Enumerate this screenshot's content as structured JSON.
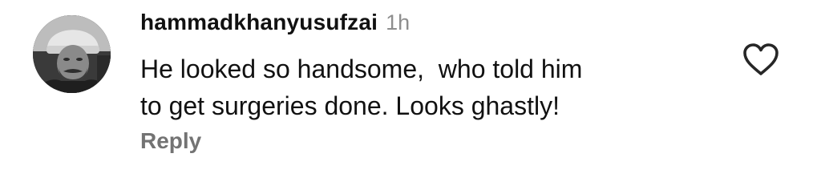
{
  "comment": {
    "username": "hammadkhanyusufzai",
    "time": "1h",
    "text": "He looked so handsome,  who told him\nto get surgeries done. Looks ghastly!",
    "reply_label": "Reply"
  },
  "icons": {
    "like": "heart-outline-icon",
    "avatar": "profile-photo"
  },
  "colors": {
    "text": "#111111",
    "muted": "#8e8e8e",
    "reply": "#737373",
    "icon": "#262626"
  }
}
